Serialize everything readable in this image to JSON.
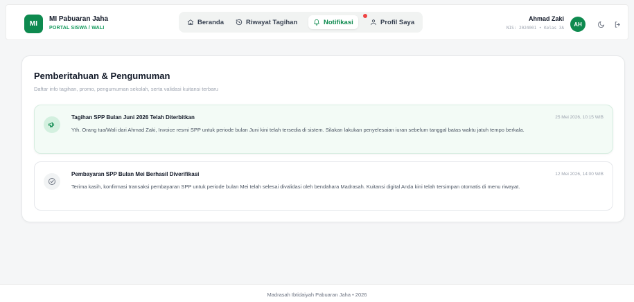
{
  "brand": {
    "logo_text": "MI",
    "school_name": "MI Pabuaran Jaha",
    "portal_label": "PORTAL SISWA / WALI",
    "accent_color": "#0e8a4f"
  },
  "nav": {
    "items": [
      {
        "label": "Beranda",
        "icon": "home-icon"
      },
      {
        "label": "Riwayat Tagihan",
        "icon": "history-icon"
      },
      {
        "label": "Notifikasi",
        "icon": "bell-icon",
        "active": true,
        "has_unread_dot": true
      },
      {
        "label": "Profil Saya",
        "icon": "user-icon"
      }
    ]
  },
  "user": {
    "name": "Ahmad Zaki",
    "meta": "NIS: 2024001 • Kelas 3A",
    "initials": "AH"
  },
  "page": {
    "title": "Pemberitahuan & Pengumuman",
    "subtitle": "Daftar info tagihan, promo, pengumuman sekolah, serta validasi kuitansi terbaru"
  },
  "notifications": [
    {
      "title": "Tagihan SPP Bulan Juni 2026 Telah Diterbitkan",
      "time": "25 Mei 2026, 10:15 WIB",
      "body": "Yth. Orang tua/Wali dari Ahmad Zaki, Invoice resmi SPP untuk periode bulan Juni kini telah tersedia di sistem. Silakan lakukan penyelesaian iuran sebelum tanggal batas waktu jatuh tempo berkala.",
      "icon": "megaphone-icon",
      "unread": true
    },
    {
      "title": "Pembayaran SPP Bulan Mei Berhasil Diverifikasi",
      "time": "12 Mei 2026, 14:00 WIB",
      "body": "Terima kasih, konfirmasi transaksi pembayaran SPP untuk periode bulan Mei telah selesai divalidasi oleh bendahara Madrasah. Kuitansi digital Anda kini telah tersimpan otomatis di menu riwayat.",
      "icon": "check-circle-icon",
      "unread": false
    }
  ],
  "footer": {
    "text": "Madrasah Ibtidaiyah Pabuaran Jaha • 2026"
  }
}
